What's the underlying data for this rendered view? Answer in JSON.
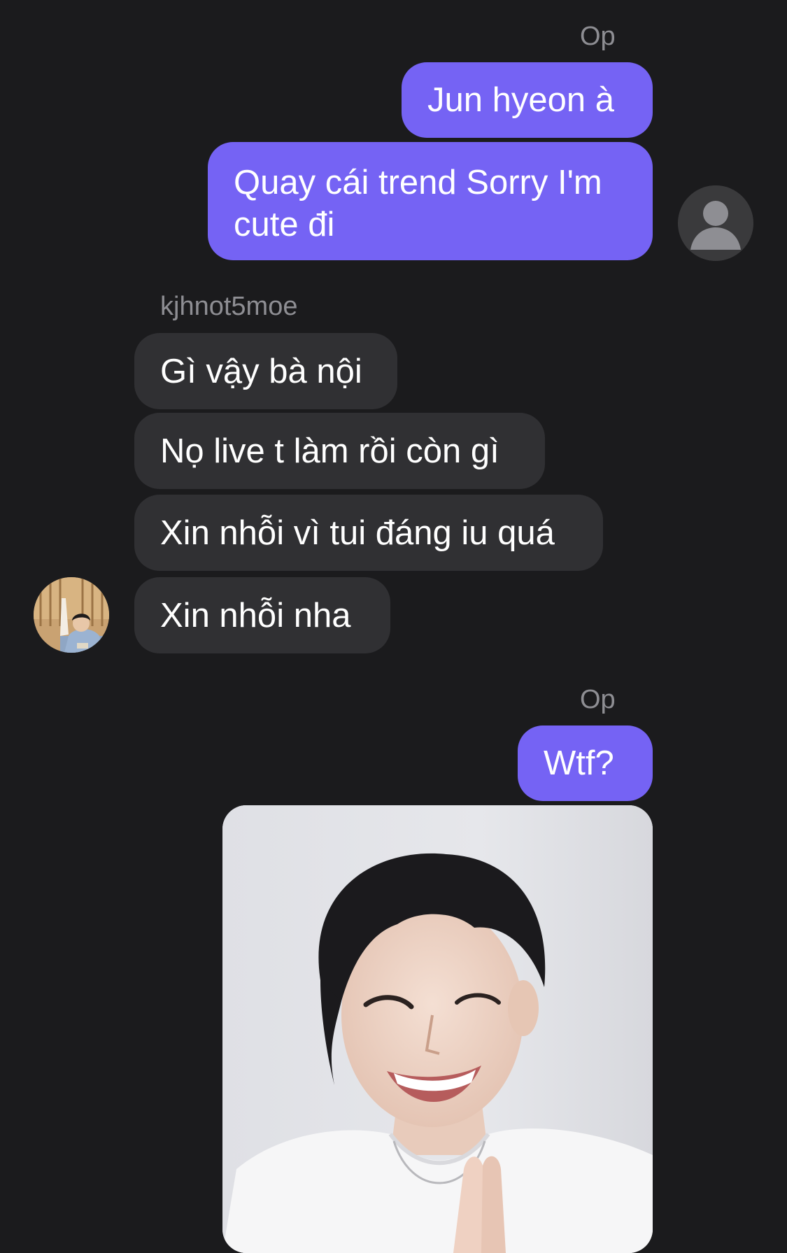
{
  "thread": {
    "group_1": {
      "sender": "Op",
      "messages": [
        "Jun hyeon à",
        "Quay cái trend Sorry I'm cute đi"
      ]
    },
    "group_2": {
      "sender": "kjhnot5moe",
      "messages": [
        "Gì vậy bà nội",
        "Nọ live t làm rồi còn gì",
        "Xin nhỗi vì tui đáng iu quá",
        "Xin nhỗi nha"
      ]
    },
    "group_3": {
      "sender": "Op",
      "messages": [
        "Wtf?"
      ]
    }
  },
  "icons": {
    "own_avatar": "default-user-avatar-icon",
    "contact_avatar": "contact-profile-photo"
  },
  "colors": {
    "background": "#1b1b1d",
    "outgoing_bubble": "#7563f4",
    "incoming_bubble": "#303033",
    "sender_label": "#8e8e93"
  }
}
